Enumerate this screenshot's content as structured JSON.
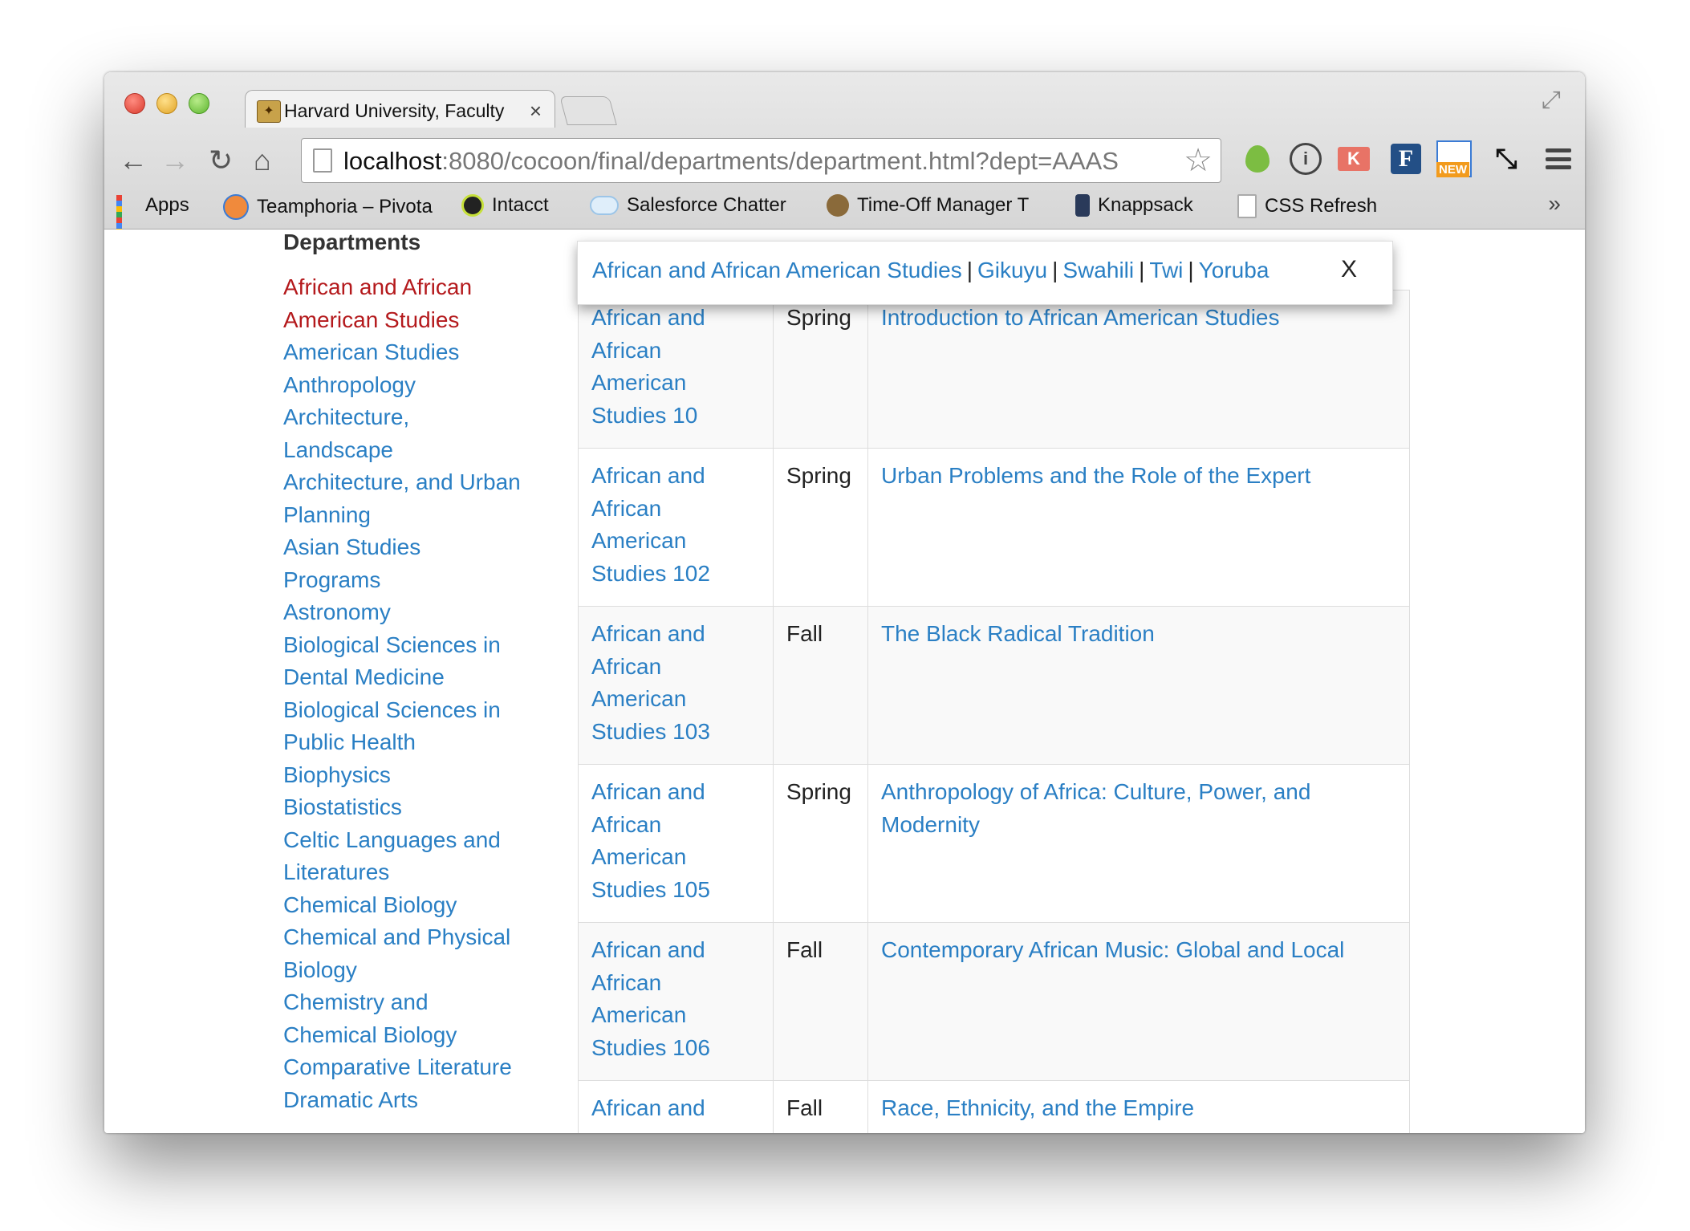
{
  "browser": {
    "tab_title": "Harvard University, Faculty",
    "tab_close": "×",
    "url_host": "localhost",
    "url_rest": ":8080/cocoon/final/departments/department.html?dept=AAAS",
    "bookmarks": [
      {
        "label": "Apps",
        "icon": "apps-grid-icon"
      },
      {
        "label": "Teamphoria – Pivota",
        "icon": "teamphoria-icon"
      },
      {
        "label": "Intacct",
        "icon": "intacct-icon"
      },
      {
        "label": "Salesforce Chatter",
        "icon": "cloud-icon"
      },
      {
        "label": "Time-Off Manager T",
        "icon": "time-off-icon"
      },
      {
        "label": "Knappsack",
        "icon": "knappsack-icon"
      },
      {
        "label": "CSS Refresh",
        "icon": "document-icon"
      }
    ],
    "bookmarks_more": "»",
    "extensions": {
      "klout": "K",
      "f": "F",
      "new_badge": "NEW"
    }
  },
  "sidebar": {
    "title": "Departments",
    "items": [
      {
        "label": "African and African American Studies",
        "active": true
      },
      {
        "label": "American Studies"
      },
      {
        "label": "Anthropology"
      },
      {
        "label": "Architecture, Landscape"
      },
      {
        "label": "Architecture, and Urban Planning"
      },
      {
        "label": "Asian Studies Programs"
      },
      {
        "label": "Astronomy"
      },
      {
        "label": "Biological Sciences in Dental Medicine"
      },
      {
        "label": "Biological Sciences in Public Health"
      },
      {
        "label": "Biophysics"
      },
      {
        "label": "Biostatistics"
      },
      {
        "label": "Celtic Languages and Literatures"
      },
      {
        "label": "Chemical Biology"
      },
      {
        "label": "Chemical and Physical Biology"
      },
      {
        "label": "Chemistry and Chemical Biology"
      },
      {
        "label": "Comparative Literature"
      },
      {
        "label": "Dramatic Arts"
      }
    ]
  },
  "popup": {
    "links": [
      "African and African American Studies",
      "Gikuyu",
      "Swahili",
      "Twi",
      "Yoruba"
    ],
    "separator": "|",
    "close": "X"
  },
  "courses": {
    "rows": [
      {
        "course": "African and African American Studies 10",
        "term": "Spring",
        "title": "Introduction to African American Studies"
      },
      {
        "course": "African and African American Studies 102",
        "term": "Spring",
        "title": "Urban Problems and the Role of the Expert"
      },
      {
        "course": "African and African American Studies 103",
        "term": "Fall",
        "title": "The Black Radical Tradition"
      },
      {
        "course": "African and African American Studies 105",
        "term": "Spring",
        "title": "Anthropology of Africa: Culture, Power, and Modernity"
      },
      {
        "course": "African and African American Studies 106",
        "term": "Fall",
        "title": "Contemporary African Music: Global and Local"
      },
      {
        "course": "African and",
        "term": "Fall",
        "title": "Race, Ethnicity, and the Empire"
      }
    ]
  },
  "colors": {
    "link": "#2a7fc4",
    "active": "#b4191c"
  }
}
